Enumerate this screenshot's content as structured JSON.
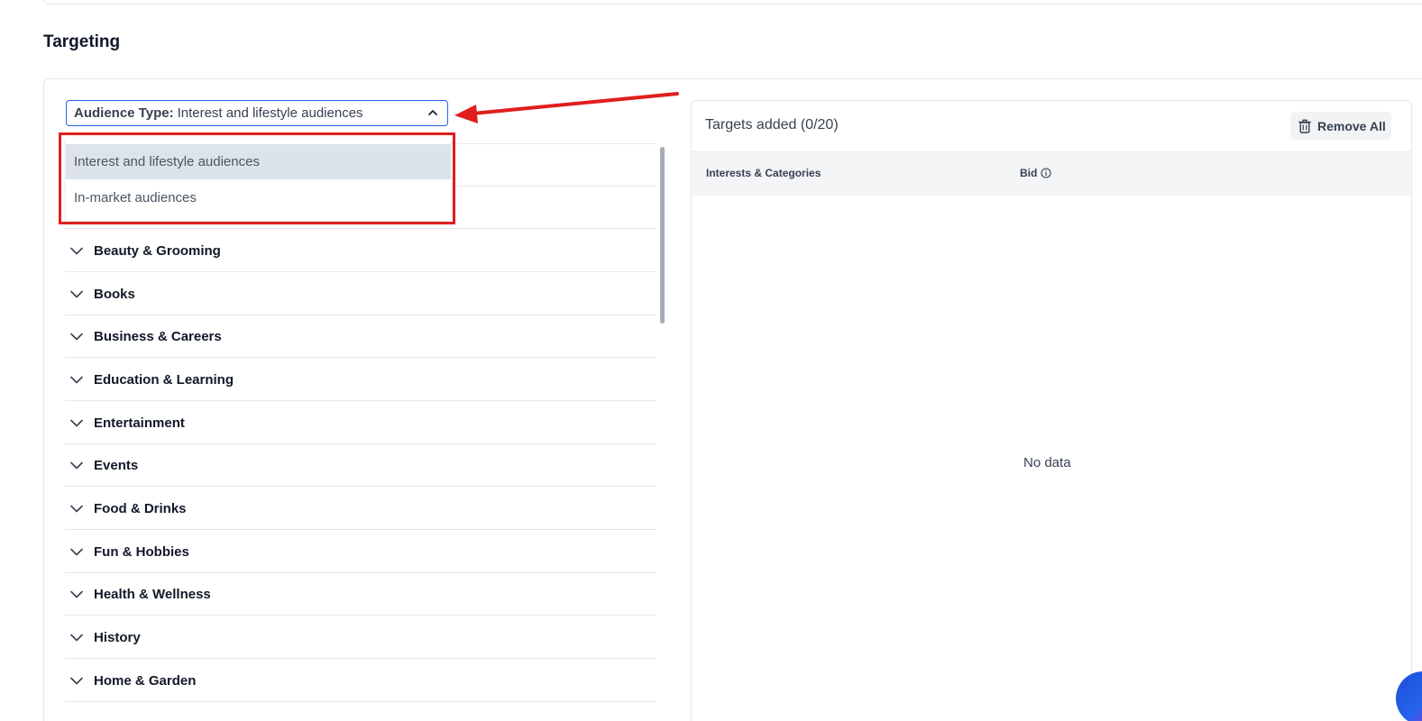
{
  "section": {
    "title": "Targeting"
  },
  "audience_select": {
    "label": "Audience Type:",
    "value": "Interest and lifestyle audiences",
    "options": [
      "Interest and lifestyle audiences",
      "In-market audiences"
    ]
  },
  "categories": [
    "",
    "",
    "Beauty & Grooming",
    "Books",
    "Business & Careers",
    "Education & Learning",
    "Entertainment",
    "Events",
    "Food & Drinks",
    "Fun & Hobbies",
    "Health & Wellness",
    "History",
    "Home & Garden"
  ],
  "targets": {
    "title": "Targets added (0/20)",
    "remove_all_label": "Remove All",
    "col_interests": "Interests & Categories",
    "col_bid": "Bid",
    "empty_text": "No data"
  },
  "colors": {
    "accent": "#2563eb",
    "highlight": "#e01e1e",
    "selected_option_bg": "#dde3ea"
  }
}
